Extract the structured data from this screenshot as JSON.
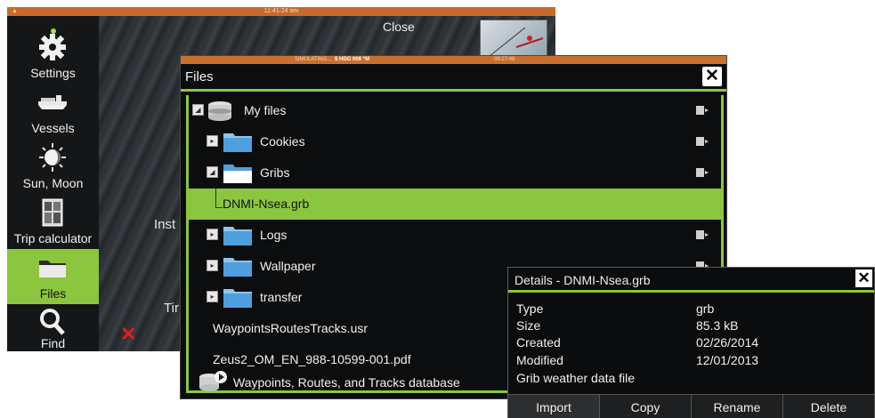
{
  "back_screen": {
    "status_time": "11:41:24 am",
    "close_label": "Close",
    "covered_text_1": "Inst",
    "covered_text_2": "Tir"
  },
  "sidebar": {
    "items": [
      {
        "label": "Settings",
        "icon": "gear-icon"
      },
      {
        "label": "Vessels",
        "icon": "vessels-icon"
      },
      {
        "label": "Sun, Moon",
        "icon": "sun-moon-icon"
      },
      {
        "label": "Trip calculator",
        "icon": "calculator-icon"
      },
      {
        "label": "Files",
        "icon": "folder-icon",
        "active": true
      },
      {
        "label": "Find",
        "icon": "search-icon"
      }
    ]
  },
  "files_window": {
    "status_simulating": "SIMULATING...",
    "status_hdg": "$ HDG 006 °M",
    "status_time": "09:27:48",
    "title": "Files",
    "close_glyph": "✕",
    "rows": [
      {
        "label": "My files",
        "kind": "drive"
      },
      {
        "label": "Cookies",
        "kind": "folder"
      },
      {
        "label": "Gribs",
        "kind": "folder-open"
      },
      {
        "label": "DNMI-Nsea.grb",
        "kind": "file-selected"
      },
      {
        "label": "Logs",
        "kind": "folder"
      },
      {
        "label": "Wallpaper",
        "kind": "folder"
      },
      {
        "label": "transfer",
        "kind": "folder"
      },
      {
        "label": "WaypointsRoutesTracks.usr",
        "kind": "file"
      },
      {
        "label": "Zeus2_OM_EN_988-10599-001.pdf",
        "kind": "file"
      },
      {
        "label": "Waypoints, Routes, and Tracks database",
        "kind": "database"
      }
    ]
  },
  "details": {
    "title": "Details - DNMI-Nsea.grb",
    "close_glyph": "✕",
    "fields": [
      {
        "label": "Type",
        "value": "grb"
      },
      {
        "label": "Size",
        "value": "85.3 kB"
      },
      {
        "label": "Created",
        "value": "02/26/2014"
      },
      {
        "label": "Modified",
        "value": "12/01/2013"
      },
      {
        "label": "Grib weather data file",
        "value": ""
      }
    ],
    "actions": [
      "Import",
      "Copy",
      "Rename",
      "Delete"
    ]
  },
  "colors": {
    "accent": "#8cc63f",
    "status_bar": "#c9702e",
    "background": "#0c0d0e"
  }
}
